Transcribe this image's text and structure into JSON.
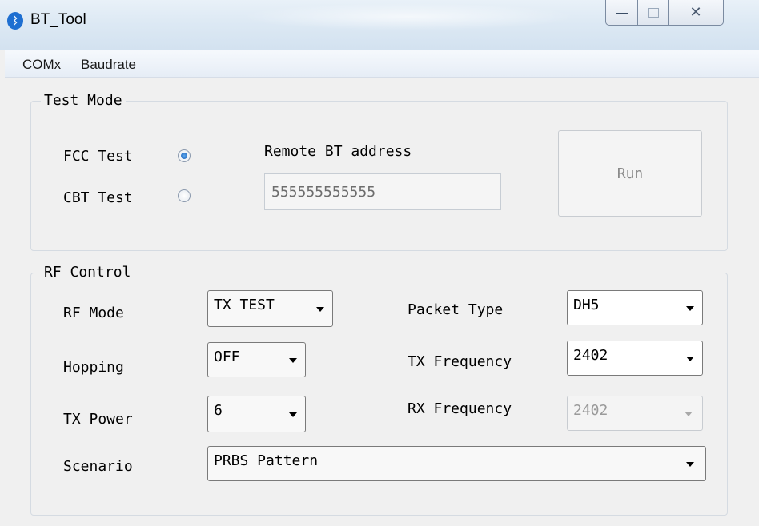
{
  "window": {
    "title": "BT_Tool",
    "icon": "bluetooth-icon",
    "caption_buttons": {
      "close_glyph": "✕"
    }
  },
  "menu": {
    "items": [
      {
        "label": "COMx"
      },
      {
        "label": "Baudrate"
      }
    ]
  },
  "test_mode": {
    "title": "Test Mode",
    "options": [
      {
        "label": "FCC Test",
        "checked": true
      },
      {
        "label": "CBT Test",
        "checked": false
      }
    ],
    "remote_address_label": "Remote BT address",
    "remote_address_value": "555555555555",
    "run_label": "Run"
  },
  "rf_control": {
    "title": "RF Control",
    "rf_mode": {
      "label": "RF Mode",
      "value": "TX TEST"
    },
    "hopping": {
      "label": "Hopping",
      "value": "OFF"
    },
    "tx_power": {
      "label": "TX Power",
      "value": "6"
    },
    "scenario": {
      "label": "Scenario",
      "value": "PRBS Pattern"
    },
    "packet_type": {
      "label": "Packet Type",
      "value": "DH5"
    },
    "tx_frequency": {
      "label": "TX Frequency",
      "value": "2402"
    },
    "rx_frequency": {
      "label": "RX Frequency",
      "value": "2402",
      "enabled": false
    }
  },
  "colors": {
    "window_bg": "#f0f0f0",
    "titlebar": "#dde9f4",
    "accent": "#1e6fd1",
    "disabled_text": "#8a8a8a"
  }
}
